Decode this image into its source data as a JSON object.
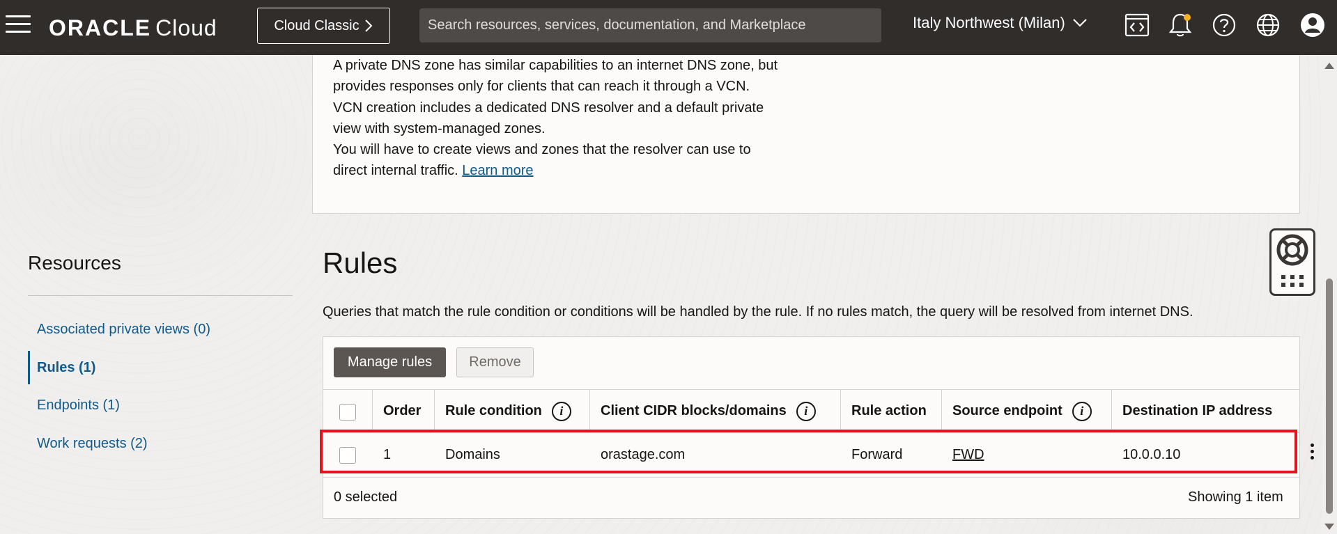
{
  "header": {
    "brand_oracle": "ORACLE",
    "brand_cloud": "Cloud",
    "classic_button": "Cloud Classic",
    "search_placeholder": "Search resources, services, documentation, and Marketplace",
    "region": "Italy Northwest (Milan)"
  },
  "info": {
    "lines": [
      "A private DNS zone has similar capabilities to an internet DNS zone, but",
      "provides responses only for clients that can reach it through a VCN.",
      "VCN creation includes a dedicated DNS resolver and a default private",
      "view with system-managed zones.",
      "You will have to create views and zones that the resolver can use to"
    ],
    "last_line_prefix": "direct internal traffic.",
    "learn_more": "Learn more"
  },
  "resources": {
    "title": "Resources",
    "items": [
      {
        "label": "Associated private views (0)"
      },
      {
        "label": "Rules (1)"
      },
      {
        "label": "Endpoints (1)"
      },
      {
        "label": "Work requests (2)"
      }
    ]
  },
  "rules": {
    "title": "Rules",
    "description": "Queries that match the rule condition or conditions will be handled by the rule. If no rules match, the query will be resolved from internet DNS.",
    "manage_button": "Manage rules",
    "remove_button": "Remove",
    "columns": {
      "order": "Order",
      "rule_condition": "Rule condition",
      "client_cidr": "Client CIDR blocks/domains",
      "rule_action": "Rule action",
      "source_endpoint": "Source endpoint",
      "destination_ip": "Destination IP address"
    },
    "rows": [
      {
        "order": "1",
        "rule_condition": "Domains",
        "client_cidr": "orastage.com",
        "rule_action": "Forward",
        "source_endpoint": "FWD",
        "destination_ip": "10.0.0.10"
      }
    ],
    "selected_count": "0 selected",
    "showing": "Showing 1 item"
  },
  "colors": {
    "header_bg": "#312d2a",
    "link": "#0f5a8a",
    "highlight": "#e3141b",
    "primary_button": "#5b5652"
  }
}
